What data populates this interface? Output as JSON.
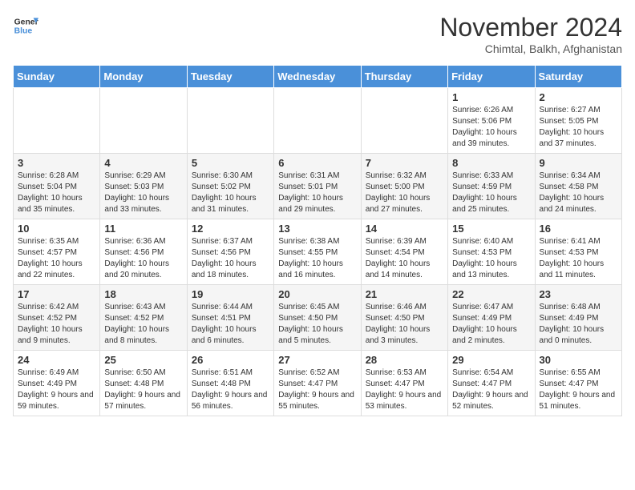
{
  "logo": {
    "line1": "General",
    "line2": "Blue"
  },
  "title": "November 2024",
  "location": "Chimtal, Balkh, Afghanistan",
  "days_header": [
    "Sunday",
    "Monday",
    "Tuesday",
    "Wednesday",
    "Thursday",
    "Friday",
    "Saturday"
  ],
  "weeks": [
    [
      {
        "day": "",
        "info": ""
      },
      {
        "day": "",
        "info": ""
      },
      {
        "day": "",
        "info": ""
      },
      {
        "day": "",
        "info": ""
      },
      {
        "day": "",
        "info": ""
      },
      {
        "day": "1",
        "info": "Sunrise: 6:26 AM\nSunset: 5:06 PM\nDaylight: 10 hours and 39 minutes."
      },
      {
        "day": "2",
        "info": "Sunrise: 6:27 AM\nSunset: 5:05 PM\nDaylight: 10 hours and 37 minutes."
      }
    ],
    [
      {
        "day": "3",
        "info": "Sunrise: 6:28 AM\nSunset: 5:04 PM\nDaylight: 10 hours and 35 minutes."
      },
      {
        "day": "4",
        "info": "Sunrise: 6:29 AM\nSunset: 5:03 PM\nDaylight: 10 hours and 33 minutes."
      },
      {
        "day": "5",
        "info": "Sunrise: 6:30 AM\nSunset: 5:02 PM\nDaylight: 10 hours and 31 minutes."
      },
      {
        "day": "6",
        "info": "Sunrise: 6:31 AM\nSunset: 5:01 PM\nDaylight: 10 hours and 29 minutes."
      },
      {
        "day": "7",
        "info": "Sunrise: 6:32 AM\nSunset: 5:00 PM\nDaylight: 10 hours and 27 minutes."
      },
      {
        "day": "8",
        "info": "Sunrise: 6:33 AM\nSunset: 4:59 PM\nDaylight: 10 hours and 25 minutes."
      },
      {
        "day": "9",
        "info": "Sunrise: 6:34 AM\nSunset: 4:58 PM\nDaylight: 10 hours and 24 minutes."
      }
    ],
    [
      {
        "day": "10",
        "info": "Sunrise: 6:35 AM\nSunset: 4:57 PM\nDaylight: 10 hours and 22 minutes."
      },
      {
        "day": "11",
        "info": "Sunrise: 6:36 AM\nSunset: 4:56 PM\nDaylight: 10 hours and 20 minutes."
      },
      {
        "day": "12",
        "info": "Sunrise: 6:37 AM\nSunset: 4:56 PM\nDaylight: 10 hours and 18 minutes."
      },
      {
        "day": "13",
        "info": "Sunrise: 6:38 AM\nSunset: 4:55 PM\nDaylight: 10 hours and 16 minutes."
      },
      {
        "day": "14",
        "info": "Sunrise: 6:39 AM\nSunset: 4:54 PM\nDaylight: 10 hours and 14 minutes."
      },
      {
        "day": "15",
        "info": "Sunrise: 6:40 AM\nSunset: 4:53 PM\nDaylight: 10 hours and 13 minutes."
      },
      {
        "day": "16",
        "info": "Sunrise: 6:41 AM\nSunset: 4:53 PM\nDaylight: 10 hours and 11 minutes."
      }
    ],
    [
      {
        "day": "17",
        "info": "Sunrise: 6:42 AM\nSunset: 4:52 PM\nDaylight: 10 hours and 9 minutes."
      },
      {
        "day": "18",
        "info": "Sunrise: 6:43 AM\nSunset: 4:52 PM\nDaylight: 10 hours and 8 minutes."
      },
      {
        "day": "19",
        "info": "Sunrise: 6:44 AM\nSunset: 4:51 PM\nDaylight: 10 hours and 6 minutes."
      },
      {
        "day": "20",
        "info": "Sunrise: 6:45 AM\nSunset: 4:50 PM\nDaylight: 10 hours and 5 minutes."
      },
      {
        "day": "21",
        "info": "Sunrise: 6:46 AM\nSunset: 4:50 PM\nDaylight: 10 hours and 3 minutes."
      },
      {
        "day": "22",
        "info": "Sunrise: 6:47 AM\nSunset: 4:49 PM\nDaylight: 10 hours and 2 minutes."
      },
      {
        "day": "23",
        "info": "Sunrise: 6:48 AM\nSunset: 4:49 PM\nDaylight: 10 hours and 0 minutes."
      }
    ],
    [
      {
        "day": "24",
        "info": "Sunrise: 6:49 AM\nSunset: 4:49 PM\nDaylight: 9 hours and 59 minutes."
      },
      {
        "day": "25",
        "info": "Sunrise: 6:50 AM\nSunset: 4:48 PM\nDaylight: 9 hours and 57 minutes."
      },
      {
        "day": "26",
        "info": "Sunrise: 6:51 AM\nSunset: 4:48 PM\nDaylight: 9 hours and 56 minutes."
      },
      {
        "day": "27",
        "info": "Sunrise: 6:52 AM\nSunset: 4:47 PM\nDaylight: 9 hours and 55 minutes."
      },
      {
        "day": "28",
        "info": "Sunrise: 6:53 AM\nSunset: 4:47 PM\nDaylight: 9 hours and 53 minutes."
      },
      {
        "day": "29",
        "info": "Sunrise: 6:54 AM\nSunset: 4:47 PM\nDaylight: 9 hours and 52 minutes."
      },
      {
        "day": "30",
        "info": "Sunrise: 6:55 AM\nSunset: 4:47 PM\nDaylight: 9 hours and 51 minutes."
      }
    ]
  ]
}
